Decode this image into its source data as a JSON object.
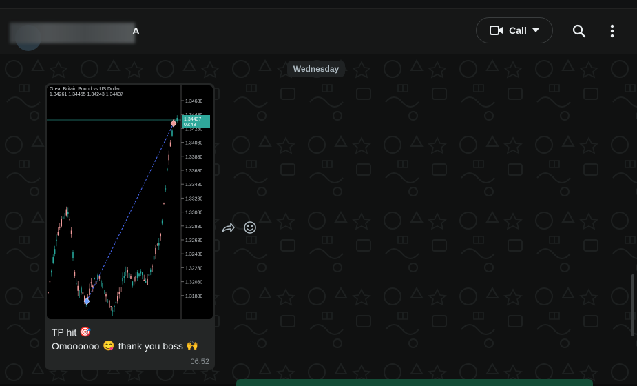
{
  "header": {
    "contact_name": "A",
    "call_label": "Call",
    "icons": [
      "video-icon",
      "chevron-down-icon",
      "search-icon",
      "more-vertical-icon"
    ]
  },
  "chat": {
    "day_separator": "Wednesday",
    "message": {
      "line1_text": "TP hit",
      "line1_emoji": "🎯",
      "line2_text_before": "Omoooooo",
      "line2_emoji1": "😋",
      "line2_text_after": "thank you boss",
      "line2_emoji2": "🙌",
      "time": "06:52"
    },
    "message_actions": [
      "forward-icon",
      "emoji-react-icon"
    ]
  },
  "trade_image": {
    "title": "Great Britain Pound vs US Dollar",
    "ohlc": "1.34261 1.34455 1.34243 1.34437",
    "price_tag_value": "1.34437",
    "price_tag_countdown": "02:43",
    "y_ticks": [
      "1.34680",
      "1.34480",
      "1.34280",
      "1.34080",
      "1.33880",
      "1.33680",
      "1.33480",
      "1.33280",
      "1.33080",
      "1.32880",
      "1.32680",
      "1.32480",
      "1.32280",
      "1.32080",
      "1.31880"
    ],
    "colors": {
      "bull": "#26a69a",
      "bear": "#ef9a9a",
      "tag_bg": "#2fa89b",
      "trend_line": "#4a6cf7"
    }
  },
  "colors": {
    "accent_green": "#144d37",
    "bubble_bg": "#242626",
    "header_bg": "#161717"
  }
}
